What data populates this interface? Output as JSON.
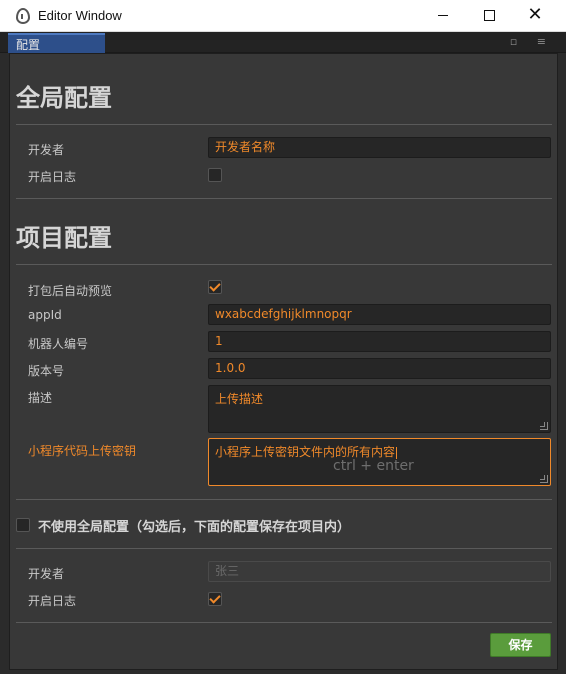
{
  "window": {
    "title": "Editor Window",
    "minimize": "",
    "maximize": "",
    "close": "✕"
  },
  "tab": {
    "label": "配置",
    "tools": "▫ ≡"
  },
  "global": {
    "title": "全局配置",
    "developer_label": "开发者",
    "developer_value": "开发者名称",
    "log_label": "开启日志",
    "log_checked": false
  },
  "project": {
    "title": "项目配置",
    "auto_preview_label": "打包后自动预览",
    "auto_preview_checked": true,
    "appid_label": "appId",
    "appid_value": "wxabcdefghijklmnopqr",
    "robot_label": "机器人编号",
    "robot_value": "1",
    "version_label": "版本号",
    "version_value": "1.0.0",
    "desc_label": "描述",
    "desc_value": "上传描述",
    "key_label": "小程序代码上传密钥",
    "key_value": "小程序上传密钥文件内的所有内容",
    "key_hint": "ctrl + enter"
  },
  "local": {
    "checkbox_label": "不使用全局配置（勾选后，下面的配置保存在项目内）",
    "checkbox_checked": false,
    "developer_label": "开发者",
    "developer_value": "张三",
    "log_label": "开启日志",
    "log_checked": true
  },
  "actions": {
    "save_label": "保存"
  },
  "colors": {
    "accent": "#f0892a",
    "save_button": "#5a9c3c",
    "tab_active": "#2d4f8a",
    "panel_bg": "#383838"
  }
}
